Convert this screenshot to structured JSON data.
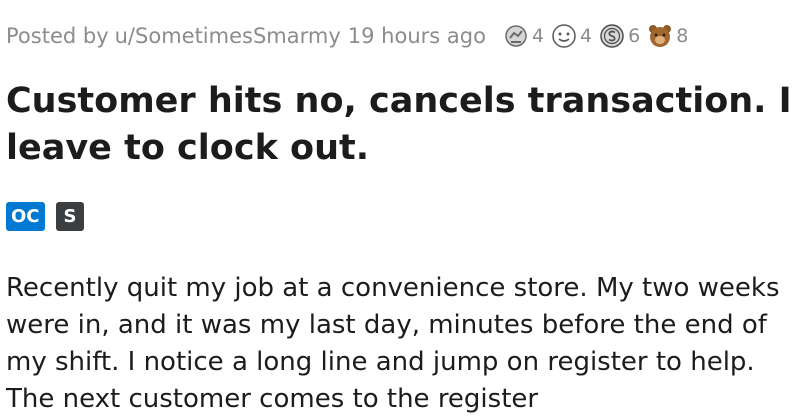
{
  "post": {
    "meta": {
      "posted_by": "Posted by",
      "username": "u/SometimesSmarmy",
      "time": "19 hours ago"
    },
    "awards": [
      {
        "icon": "helpful-award-icon",
        "count": "4"
      },
      {
        "icon": "wholesome-award-icon",
        "count": "4"
      },
      {
        "icon": "silver-coin-award-icon",
        "count": "6"
      },
      {
        "icon": "bear-award-icon",
        "count": "8"
      }
    ],
    "title": "Customer hits no, cancels transaction. I leave to clock out.",
    "tags": {
      "oc": "OC",
      "s": "S"
    },
    "body": "Recently quit my job at a convenience store. My two weeks were in, and it was my last day, minutes before the end of my shift. I notice a long line and jump on register to help. The next customer comes to the register"
  },
  "colors": {
    "meta_text": "#8a8c8e",
    "oc_tag": "#0079d3",
    "s_tag": "#3c3f42"
  }
}
